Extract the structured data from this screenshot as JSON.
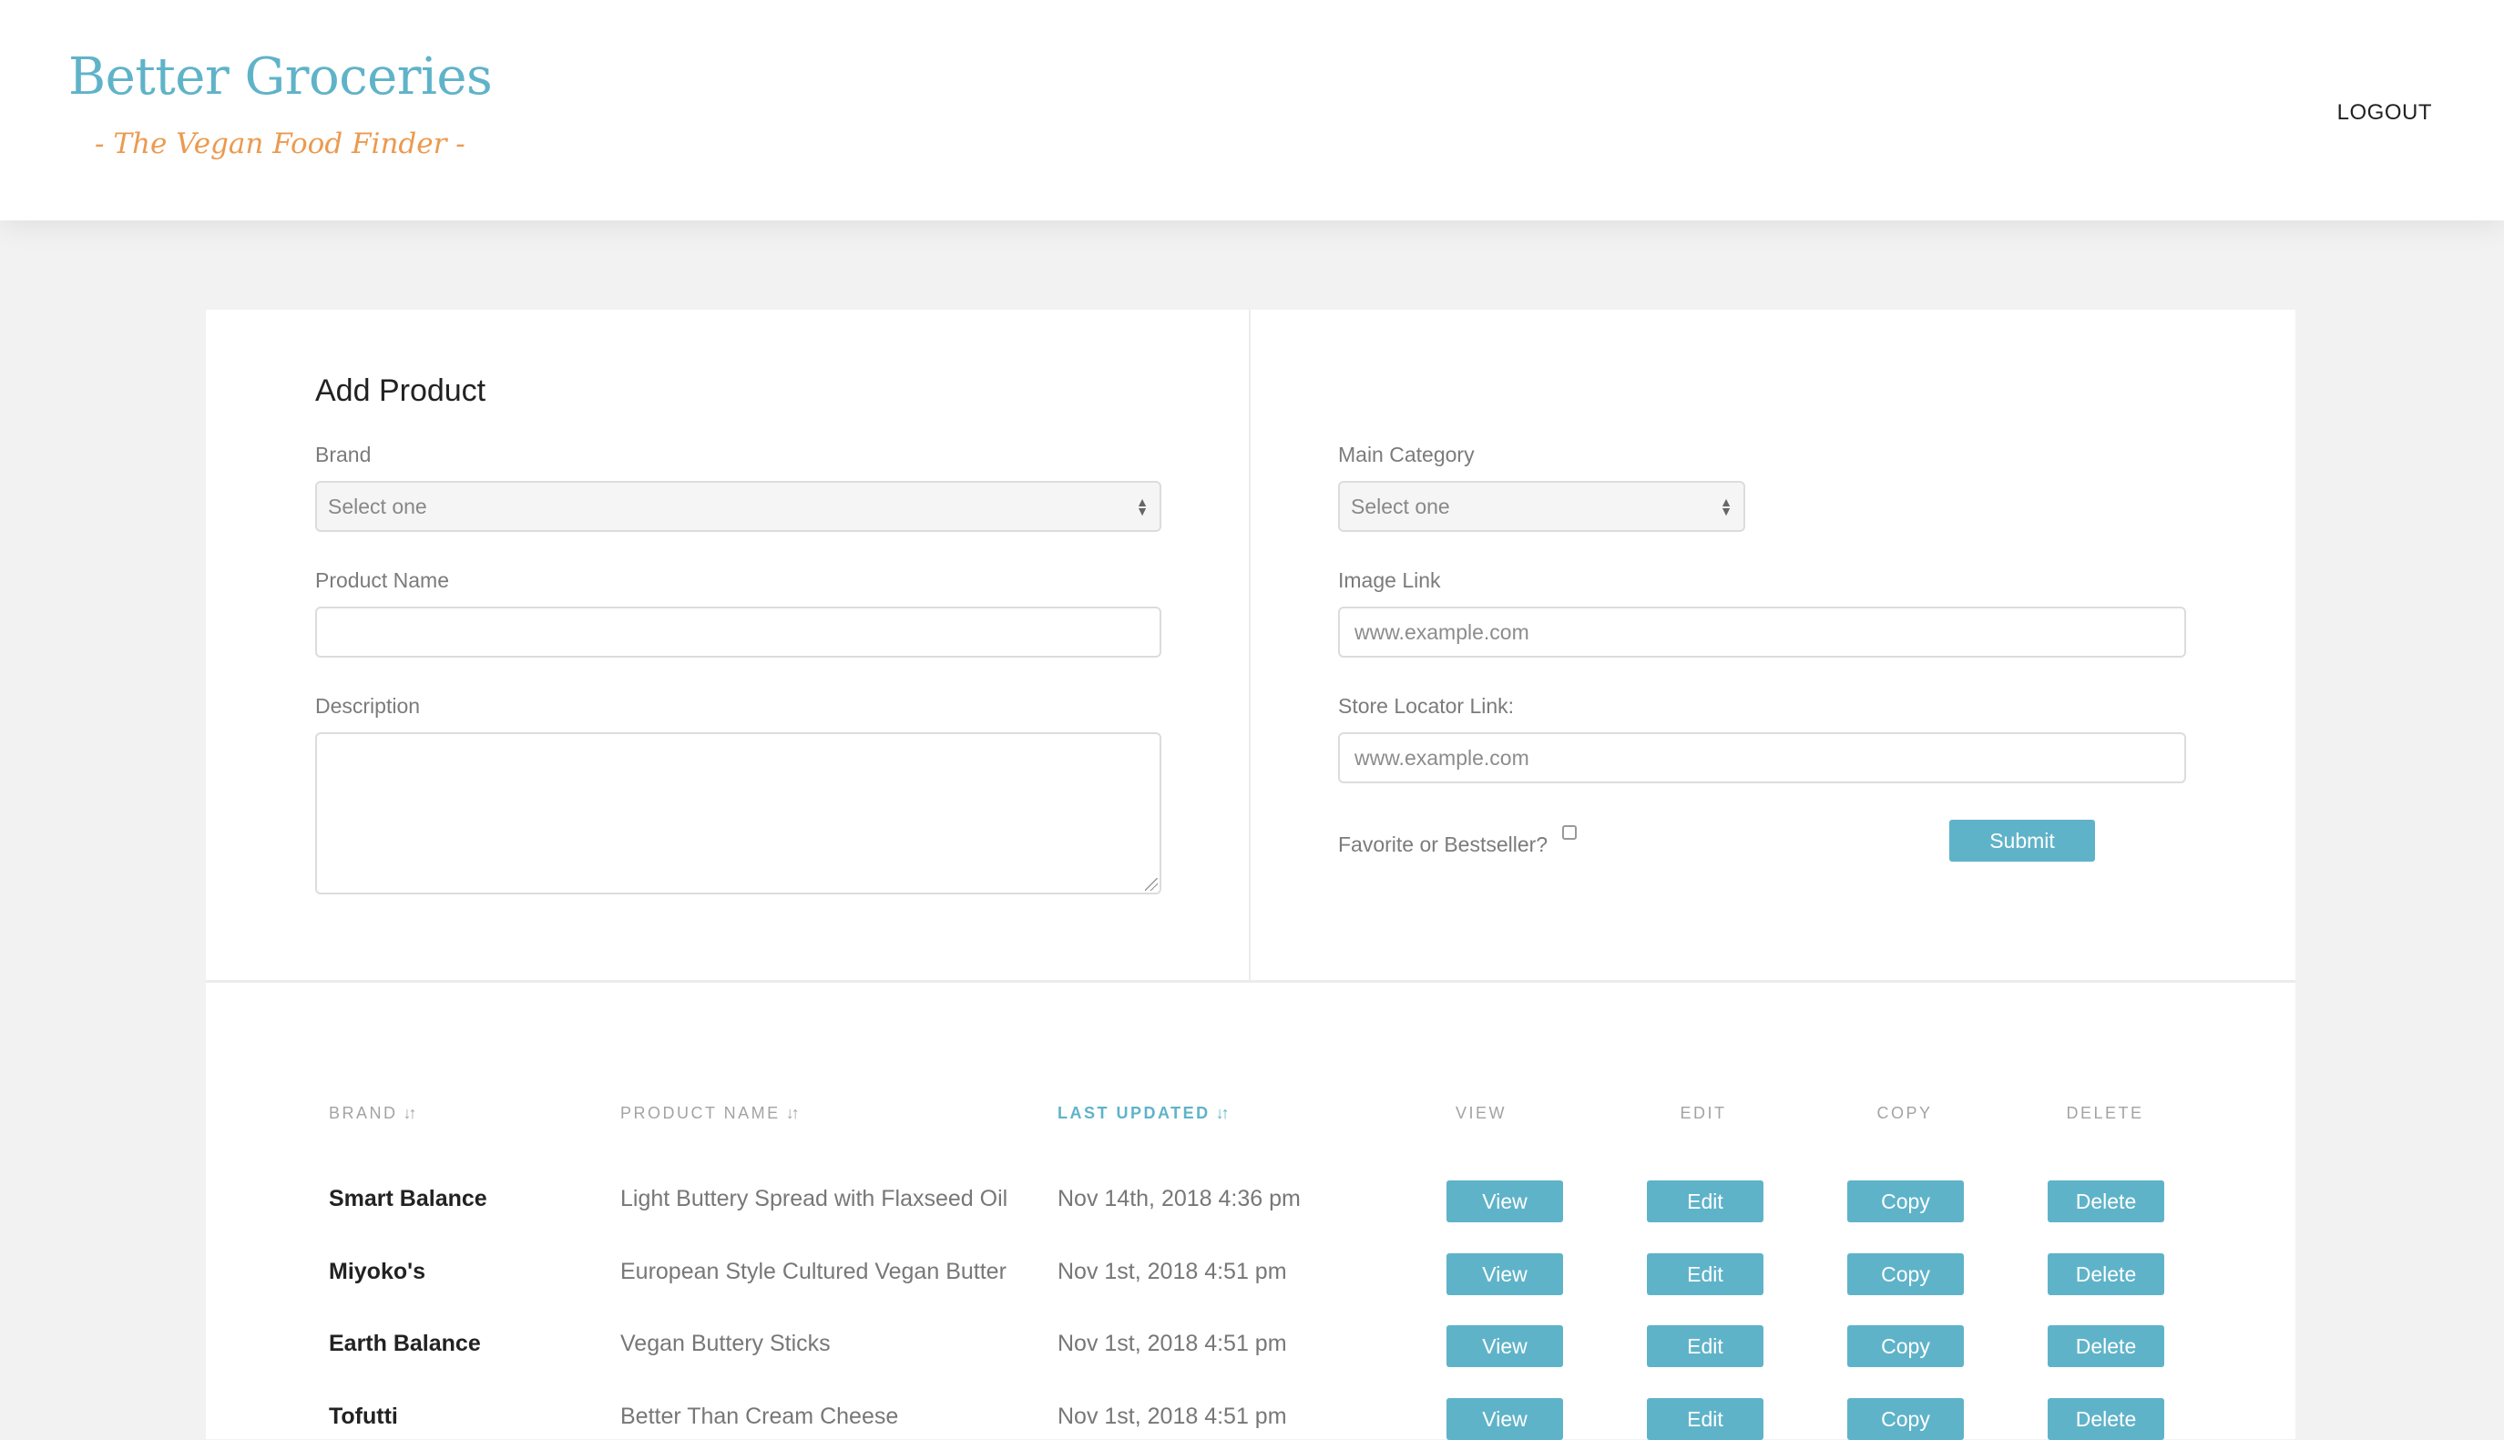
{
  "header": {
    "title": "Better Groceries",
    "tagline": "- The Vegan Food Finder -",
    "logout_label": "LOGOUT"
  },
  "form": {
    "title": "Add Product",
    "brand": {
      "label": "Brand",
      "value": "Select one"
    },
    "product_name": {
      "label": "Product Name",
      "value": ""
    },
    "description": {
      "label": "Description",
      "value": ""
    },
    "main_category": {
      "label": "Main Category",
      "value": "Select one"
    },
    "image_link": {
      "label": "Image Link",
      "placeholder": "www.example.com"
    },
    "store_locator": {
      "label": "Store Locator Link:",
      "placeholder": "www.example.com"
    },
    "favorite": {
      "label": "Favorite or Bestseller?",
      "checked": false
    },
    "submit_label": "Submit"
  },
  "table": {
    "headers": {
      "brand": "BRAND",
      "product_name": "PRODUCT NAME",
      "last_updated": "LAST UPDATED",
      "view": "VIEW",
      "edit": "EDIT",
      "copy": "COPY",
      "delete": "DELETE"
    },
    "sort_icon": "sort-icon",
    "action_labels": {
      "view": "View",
      "edit": "Edit",
      "copy": "Copy",
      "delete": "Delete"
    },
    "rows": [
      {
        "brand": "Smart Balance",
        "product": "Light Buttery Spread with Flaxseed Oil",
        "updated": "Nov 14th, 2018 4:36 pm"
      },
      {
        "brand": "Miyoko's",
        "product": "European Style Cultured Vegan Butter",
        "updated": "Nov 1st, 2018 4:51 pm"
      },
      {
        "brand": "Earth Balance",
        "product": "Vegan Buttery Sticks",
        "updated": "Nov 1st, 2018 4:51 pm"
      },
      {
        "brand": "Tofutti",
        "product": "Better Than Cream Cheese",
        "updated": "Nov 1st, 2018 4:51 pm"
      }
    ]
  },
  "colors": {
    "accent": "#5fb3c9",
    "tagline": "#eb9a4f",
    "background": "#f2f2f2"
  }
}
